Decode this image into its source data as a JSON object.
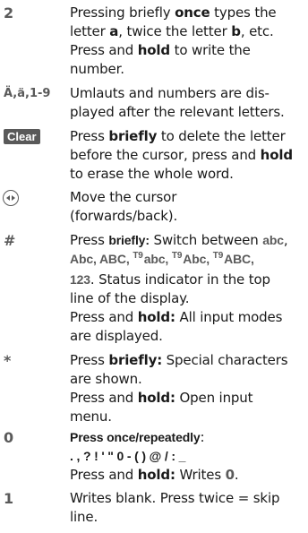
{
  "entries": [
    {
      "key": "2",
      "l1": [
        "Pressing briefly ",
        "once",
        " types the"
      ],
      "l2": [
        "letter ",
        "a",
        ", twice the letter ",
        "b",
        ", etc."
      ],
      "l3": "Press and ",
      "l3b": "hold",
      "l3c": " to write the",
      "l4": "number."
    },
    {
      "key": "Ä,ä,1-9",
      "l1": "Umlauts and numbers are dis-",
      "l2": "played after the relevant letters."
    },
    {
      "key": "Clear",
      "l1a": "Press ",
      "l1b": "briefly",
      "l1c": " to delete the letter",
      "l2a": "before the cursor, press and ",
      "l2b": "hold",
      "l3": "to erase the whole word."
    },
    {
      "key_icon": "navigation-left-right-icon",
      "l1": "Move the cursor",
      "l2": "(forwards/back)."
    },
    {
      "key": "#",
      "l1a": "Press ",
      "l1b": "briefly:",
      "l1c": " Switch between ",
      "l1d": "abc",
      "modes": [
        "abc",
        "Abc",
        "ABC"
      ],
      "t9": [
        "T9",
        "abc",
        "T9",
        "Abc",
        "T9",
        "ABC"
      ],
      "l3a": "123",
      "l3b": ". Status indicator in the top",
      "l4": "line of the display.",
      "l5a": "Press and ",
      "l5b": "hold:",
      "l5c": " All input modes",
      "l6": "are displayed."
    },
    {
      "key": "*",
      "l1a": "Press ",
      "l1b": "briefly:",
      "l1c": " Special characters",
      "l2": "are shown.",
      "l3a": "Press and ",
      "l3b": "hold:",
      "l3c": " Open input",
      "l4": "menu."
    },
    {
      "key": "0",
      "l1a": "Press once/repeatedly",
      "l1b": ":",
      "l2": ". , ? ! ' \" 0 - ( ) @ / : _",
      "l3a": "Press and ",
      "l3b": "hold:",
      "l3c": " Writes ",
      "l3d": "0",
      "l3e": "."
    },
    {
      "key": "1",
      "l1": "Writes blank. Press twice = skip",
      "l2": "line."
    }
  ]
}
